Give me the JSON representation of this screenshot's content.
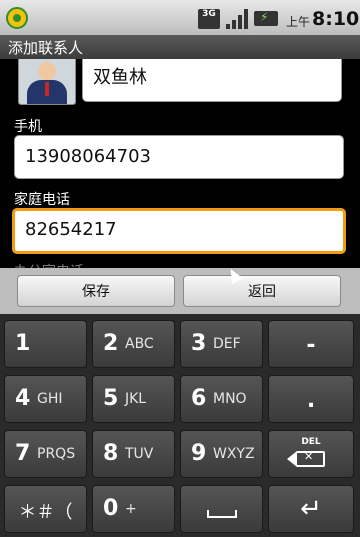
{
  "statusbar": {
    "network": "3G",
    "ampm": "上午",
    "time": "8:10"
  },
  "titlebar": {
    "title": "添加联系人"
  },
  "form": {
    "name_value": "双鱼林",
    "mobile_label": "手机",
    "mobile_value": "13908064703",
    "home_label": "家庭电话",
    "home_value": "82654217",
    "office_label_partial": "办公室电话"
  },
  "actions": {
    "save": "保存",
    "back": "返回"
  },
  "keyboard": {
    "rows": [
      [
        {
          "num": "1",
          "letters": ""
        },
        {
          "num": "2",
          "letters": "ABC"
        },
        {
          "num": "3",
          "letters": "DEF"
        },
        {
          "num": "-",
          "letters": ""
        }
      ],
      [
        {
          "num": "4",
          "letters": "GHI"
        },
        {
          "num": "5",
          "letters": "JKL"
        },
        {
          "num": "6",
          "letters": "MNO"
        },
        {
          "num": ".",
          "letters": ""
        }
      ],
      [
        {
          "num": "7",
          "letters": "PRQS"
        },
        {
          "num": "8",
          "letters": "TUV"
        },
        {
          "num": "9",
          "letters": "WXYZ"
        },
        {
          "num": "",
          "letters": ""
        }
      ],
      [
        {
          "num": "＊＃（",
          "letters": ""
        },
        {
          "num": "0",
          "letters": "+"
        },
        {
          "num": "",
          "letters": ""
        },
        {
          "num": "",
          "letters": ""
        }
      ]
    ],
    "del_label": "DEL"
  }
}
